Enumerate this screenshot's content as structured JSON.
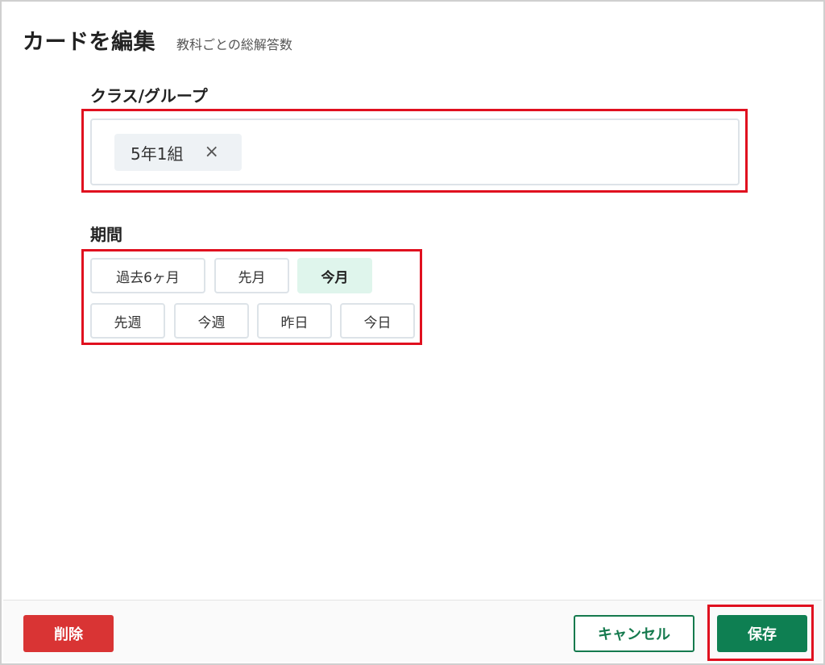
{
  "dialog": {
    "title": "カードを編集",
    "subtitle": "教科ごとの総解答数"
  },
  "class_group": {
    "label": "クラス/グループ",
    "selected": [
      {
        "label": "5年1組",
        "remove_icon": "×"
      }
    ]
  },
  "period": {
    "label": "期間",
    "options": [
      {
        "label": "過去6ヶ月",
        "active": false
      },
      {
        "label": "先月",
        "active": false
      },
      {
        "label": "今月",
        "active": true
      },
      {
        "label": "先週",
        "active": false
      },
      {
        "label": "今週",
        "active": false
      },
      {
        "label": "昨日",
        "active": false
      },
      {
        "label": "今日",
        "active": false
      }
    ]
  },
  "footer": {
    "delete_label": "削除",
    "cancel_label": "キャンセル",
    "save_label": "保存"
  },
  "colors": {
    "accent_green": "#0e7f52",
    "danger_red": "#d93434",
    "highlight_red": "#e0101f",
    "active_bg": "#dff5ec"
  }
}
